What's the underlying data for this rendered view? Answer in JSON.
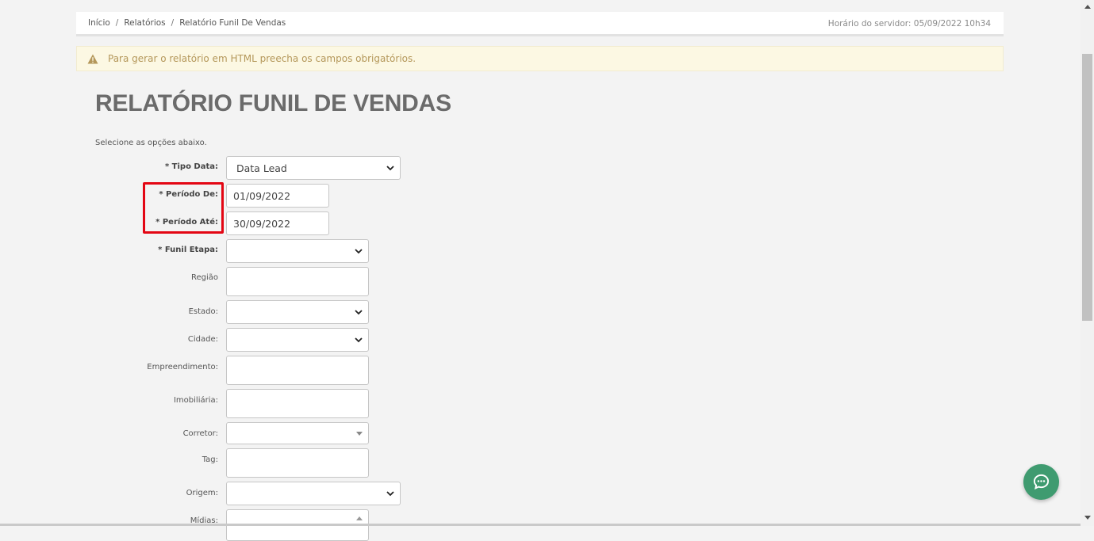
{
  "breadcrumb": {
    "items": [
      "Início",
      "Relatórios",
      "Relatório Funil De Vendas"
    ],
    "separator": "/"
  },
  "server_time": "Horário do servidor: 05/09/2022 10h34",
  "alert": {
    "text": "Para gerar o relatório em HTML preecha os campos obrigatórios.",
    "icon": "warning-icon"
  },
  "title": "RELATÓRIO FUNIL DE VENDAS",
  "subtitle": "Selecione as opções abaixo.",
  "form": {
    "tipo_data": {
      "label": "* Tipo Data:",
      "value": "Data Lead"
    },
    "periodo_de": {
      "label": "* Período De:",
      "value": "01/09/2022"
    },
    "periodo_ate": {
      "label": "* Período Até:",
      "value": "30/09/2022"
    },
    "funil_etapa": {
      "label": "* Funil Etapa:",
      "value": ""
    },
    "regiao": {
      "label": "Região",
      "value": ""
    },
    "estado": {
      "label": "Estado:",
      "value": ""
    },
    "cidade": {
      "label": "Cidade:",
      "value": ""
    },
    "empreendimento": {
      "label": "Empreendimento:",
      "value": ""
    },
    "imobiliaria": {
      "label": "Imobiliária:",
      "value": ""
    },
    "corretor": {
      "label": "Corretor:",
      "value": ""
    },
    "tag": {
      "label": "Tag:",
      "value": ""
    },
    "origem": {
      "label": "Origem:",
      "value": ""
    },
    "midias": {
      "label": "Mídias:",
      "value": ""
    }
  },
  "colors": {
    "highlight": "#e30613",
    "alert_bg": "#fcf8e3",
    "alert_text": "#b4975a",
    "chat_button": "#3f9b70"
  }
}
